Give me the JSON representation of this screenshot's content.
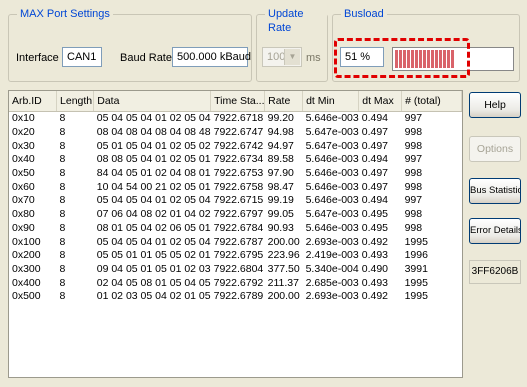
{
  "max_port": {
    "title": "MAX Port Settings",
    "interface_label": "Interface :",
    "interface_value": "CAN1",
    "baud_label": "Baud Rate :",
    "baud_value": "500.000 kBaud"
  },
  "update_rate": {
    "title": "Update Rate",
    "value": "100",
    "unit": "ms"
  },
  "busload": {
    "title": "Busload",
    "value_text": "51 %",
    "percent": 51,
    "fill_color": "#d9636a",
    "highlight_color": "#e00000"
  },
  "table": {
    "headers": [
      "Arb.ID",
      "Length",
      "Data",
      "Time Sta...",
      "Rate",
      "dt Min",
      "dt Max",
      "# (total)"
    ],
    "rows": [
      [
        "0x10",
        "8",
        "05 04 05 04 01 02 05 04",
        "7922.6718",
        "99.20",
        "5.646e-003",
        "0.494",
        "997"
      ],
      [
        "0x20",
        "8",
        "08 04 08 04 08 04 08 48",
        "7922.6747",
        "94.98",
        "5.647e-003",
        "0.497",
        "998"
      ],
      [
        "0x30",
        "8",
        "05 01 05 04 01 02 05 02",
        "7922.6742",
        "94.97",
        "5.647e-003",
        "0.497",
        "998"
      ],
      [
        "0x40",
        "8",
        "08 08 05 04 01 02 05 01",
        "7922.6734",
        "89.58",
        "5.646e-003",
        "0.494",
        "997"
      ],
      [
        "0x50",
        "8",
        "84 04 05 01 02 04 08 01",
        "7922.6753",
        "97.90",
        "5.646e-003",
        "0.497",
        "998"
      ],
      [
        "0x60",
        "8",
        "10 04 54 00 21 02 05 01",
        "7922.6758",
        "98.47",
        "5.646e-003",
        "0.497",
        "998"
      ],
      [
        "0x70",
        "8",
        "05 04 05 04 01 02 05 04",
        "7922.6715",
        "99.19",
        "5.646e-003",
        "0.494",
        "997"
      ],
      [
        "0x80",
        "8",
        "07 06 04 08 02 01 04 02",
        "7922.6797",
        "99.05",
        "5.647e-003",
        "0.495",
        "998"
      ],
      [
        "0x90",
        "8",
        "08 01 05 04 02 06 05 01",
        "7922.6784",
        "90.93",
        "5.646e-003",
        "0.495",
        "998"
      ],
      [
        "0x100",
        "8",
        "05 04 05 04 01 02 05 04",
        "7922.6787",
        "200.00",
        "2.693e-003",
        "0.492",
        "1995"
      ],
      [
        "0x200",
        "8",
        "05 05 01 01 05 05 02 01",
        "7922.6795",
        "223.96",
        "2.419e-003",
        "0.493",
        "1996"
      ],
      [
        "0x300",
        "8",
        "09 04 05 01 05 01 02 03",
        "7922.6804",
        "377.50",
        "5.340e-004",
        "0.490",
        "3991"
      ],
      [
        "0x400",
        "8",
        "02 04 05 08 01 05 04 05",
        "7922.6792",
        "211.37",
        "2.685e-003",
        "0.493",
        "1995"
      ],
      [
        "0x500",
        "8",
        "01 02 03 05 04 02 01 05",
        "7922.6789",
        "200.00",
        "2.693e-003",
        "0.492",
        "1995"
      ]
    ]
  },
  "buttons": {
    "help": "Help",
    "options": "Options",
    "bus_statistics": "Bus Statistics",
    "error_details": "Error Details"
  },
  "device_id": "3FF6206B"
}
